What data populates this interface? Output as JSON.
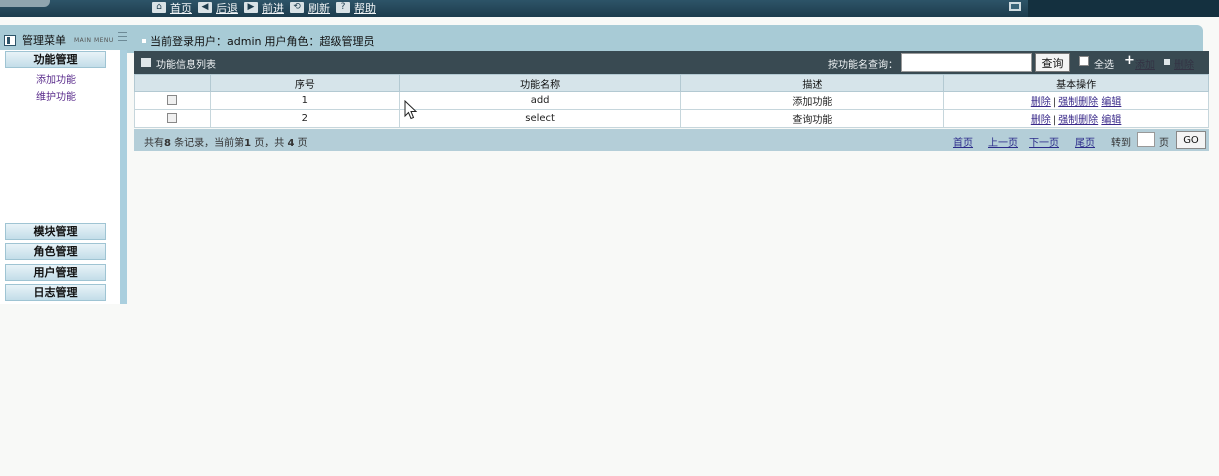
{
  "topnav": {
    "items": [
      {
        "icon": "home-icon",
        "glyph": "⌂",
        "label": "首页"
      },
      {
        "icon": "back-icon",
        "glyph": "◀",
        "label": "后退"
      },
      {
        "icon": "forward-icon",
        "glyph": "▶",
        "label": "前进"
      },
      {
        "icon": "refresh-icon",
        "glyph": "⟲",
        "label": "刷新"
      },
      {
        "icon": "help-icon",
        "glyph": "?",
        "label": "帮助"
      }
    ]
  },
  "header": {
    "menu_title": "管理菜单",
    "menu_sub": "MAIN MENU",
    "login_user_label": "当前登录用户：admin",
    "role_label": "用户角色：超级管理员"
  },
  "sidebar": {
    "sections": [
      {
        "label": "功能管理",
        "links": [
          "添加功能",
          "维护功能"
        ]
      },
      {
        "label": "模块管理"
      },
      {
        "label": "角色管理"
      },
      {
        "label": "用户管理"
      },
      {
        "label": "日志管理"
      }
    ]
  },
  "main": {
    "list_title": "功能信息列表",
    "search_label": "按功能名查询：",
    "search_value": "",
    "query_button": "查询",
    "select_all_label": "全选",
    "add_label": "添加",
    "delete_label": "删除",
    "columns": [
      "",
      "序号",
      "功能名称",
      "描述",
      "基本操作"
    ],
    "rows": [
      {
        "no": "1",
        "name": "add",
        "desc": "添加功能"
      },
      {
        "no": "2",
        "name": "select",
        "desc": "查询功能"
      }
    ],
    "ops": {
      "delete": "删除",
      "force_delete": "强制删除",
      "edit": "编辑",
      "sep": "|"
    }
  },
  "pager": {
    "summary_prefix": "共有",
    "total": "8",
    "summary_mid": "条记录，当前第",
    "current": "1",
    "summary_mid2": "页，共",
    "pages": "4",
    "summary_suffix": "页",
    "first": "首页",
    "prev": "上一页",
    "next": "下一页",
    "last": "尾页",
    "goto_label": "转到",
    "page_label": "页",
    "go_button": "GO"
  }
}
